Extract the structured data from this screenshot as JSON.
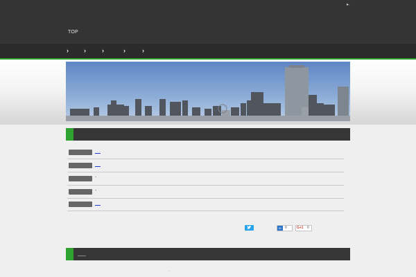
{
  "header": {
    "corner_mark": "▸.",
    "site_link": "TOP"
  },
  "nav": {
    "items": [
      "›",
      "›",
      "›",
      "›",
      "›"
    ]
  },
  "sections": [
    {
      "title": ""
    },
    {
      "title": "___"
    }
  ],
  "news": [
    {
      "text": "__",
      "is_link": true
    },
    {
      "text": "__",
      "is_link": true
    },
    {
      "text": "-",
      "is_link": false
    },
    {
      "text": "-",
      "is_link": false
    },
    {
      "text": "__",
      "is_link": true
    }
  ],
  "share": {
    "hatena_label": "B!",
    "hatena_count": "0",
    "google_label": "G+1",
    "google_count": "0"
  },
  "footer": {
    "dot": "·"
  },
  "colors": {
    "accent": "#2fa12f",
    "header": "#343434",
    "link": "#1a3bd6"
  }
}
